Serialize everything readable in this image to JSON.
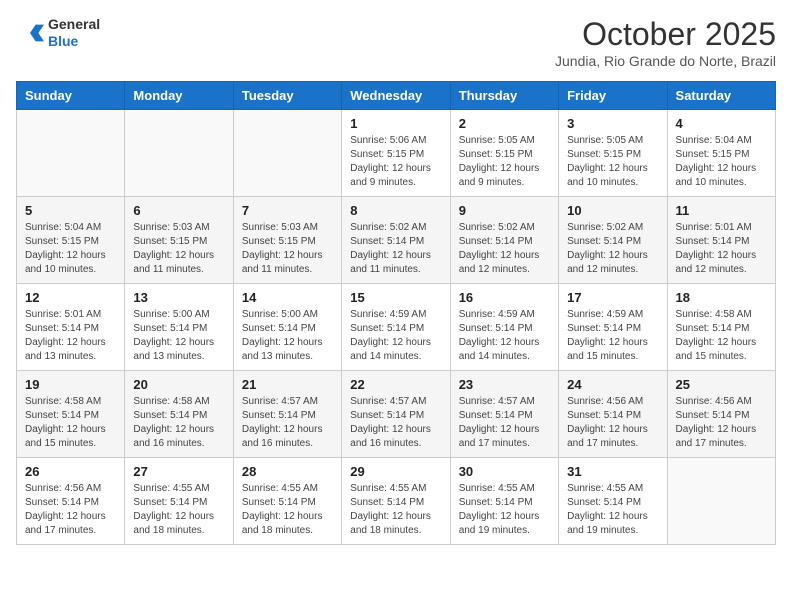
{
  "header": {
    "logo_general": "General",
    "logo_blue": "Blue",
    "title": "October 2025",
    "subtitle": "Jundia, Rio Grande do Norte, Brazil"
  },
  "calendar": {
    "days_of_week": [
      "Sunday",
      "Monday",
      "Tuesday",
      "Wednesday",
      "Thursday",
      "Friday",
      "Saturday"
    ],
    "weeks": [
      {
        "alt": false,
        "cells": [
          {
            "day": "",
            "info": ""
          },
          {
            "day": "",
            "info": ""
          },
          {
            "day": "",
            "info": ""
          },
          {
            "day": "1",
            "info": "Sunrise: 5:06 AM\nSunset: 5:15 PM\nDaylight: 12 hours and 9 minutes."
          },
          {
            "day": "2",
            "info": "Sunrise: 5:05 AM\nSunset: 5:15 PM\nDaylight: 12 hours and 9 minutes."
          },
          {
            "day": "3",
            "info": "Sunrise: 5:05 AM\nSunset: 5:15 PM\nDaylight: 12 hours and 10 minutes."
          },
          {
            "day": "4",
            "info": "Sunrise: 5:04 AM\nSunset: 5:15 PM\nDaylight: 12 hours and 10 minutes."
          }
        ]
      },
      {
        "alt": true,
        "cells": [
          {
            "day": "5",
            "info": "Sunrise: 5:04 AM\nSunset: 5:15 PM\nDaylight: 12 hours and 10 minutes."
          },
          {
            "day": "6",
            "info": "Sunrise: 5:03 AM\nSunset: 5:15 PM\nDaylight: 12 hours and 11 minutes."
          },
          {
            "day": "7",
            "info": "Sunrise: 5:03 AM\nSunset: 5:15 PM\nDaylight: 12 hours and 11 minutes."
          },
          {
            "day": "8",
            "info": "Sunrise: 5:02 AM\nSunset: 5:14 PM\nDaylight: 12 hours and 11 minutes."
          },
          {
            "day": "9",
            "info": "Sunrise: 5:02 AM\nSunset: 5:14 PM\nDaylight: 12 hours and 12 minutes."
          },
          {
            "day": "10",
            "info": "Sunrise: 5:02 AM\nSunset: 5:14 PM\nDaylight: 12 hours and 12 minutes."
          },
          {
            "day": "11",
            "info": "Sunrise: 5:01 AM\nSunset: 5:14 PM\nDaylight: 12 hours and 12 minutes."
          }
        ]
      },
      {
        "alt": false,
        "cells": [
          {
            "day": "12",
            "info": "Sunrise: 5:01 AM\nSunset: 5:14 PM\nDaylight: 12 hours and 13 minutes."
          },
          {
            "day": "13",
            "info": "Sunrise: 5:00 AM\nSunset: 5:14 PM\nDaylight: 12 hours and 13 minutes."
          },
          {
            "day": "14",
            "info": "Sunrise: 5:00 AM\nSunset: 5:14 PM\nDaylight: 12 hours and 13 minutes."
          },
          {
            "day": "15",
            "info": "Sunrise: 4:59 AM\nSunset: 5:14 PM\nDaylight: 12 hours and 14 minutes."
          },
          {
            "day": "16",
            "info": "Sunrise: 4:59 AM\nSunset: 5:14 PM\nDaylight: 12 hours and 14 minutes."
          },
          {
            "day": "17",
            "info": "Sunrise: 4:59 AM\nSunset: 5:14 PM\nDaylight: 12 hours and 15 minutes."
          },
          {
            "day": "18",
            "info": "Sunrise: 4:58 AM\nSunset: 5:14 PM\nDaylight: 12 hours and 15 minutes."
          }
        ]
      },
      {
        "alt": true,
        "cells": [
          {
            "day": "19",
            "info": "Sunrise: 4:58 AM\nSunset: 5:14 PM\nDaylight: 12 hours and 15 minutes."
          },
          {
            "day": "20",
            "info": "Sunrise: 4:58 AM\nSunset: 5:14 PM\nDaylight: 12 hours and 16 minutes."
          },
          {
            "day": "21",
            "info": "Sunrise: 4:57 AM\nSunset: 5:14 PM\nDaylight: 12 hours and 16 minutes."
          },
          {
            "day": "22",
            "info": "Sunrise: 4:57 AM\nSunset: 5:14 PM\nDaylight: 12 hours and 16 minutes."
          },
          {
            "day": "23",
            "info": "Sunrise: 4:57 AM\nSunset: 5:14 PM\nDaylight: 12 hours and 17 minutes."
          },
          {
            "day": "24",
            "info": "Sunrise: 4:56 AM\nSunset: 5:14 PM\nDaylight: 12 hours and 17 minutes."
          },
          {
            "day": "25",
            "info": "Sunrise: 4:56 AM\nSunset: 5:14 PM\nDaylight: 12 hours and 17 minutes."
          }
        ]
      },
      {
        "alt": false,
        "cells": [
          {
            "day": "26",
            "info": "Sunrise: 4:56 AM\nSunset: 5:14 PM\nDaylight: 12 hours and 17 minutes."
          },
          {
            "day": "27",
            "info": "Sunrise: 4:55 AM\nSunset: 5:14 PM\nDaylight: 12 hours and 18 minutes."
          },
          {
            "day": "28",
            "info": "Sunrise: 4:55 AM\nSunset: 5:14 PM\nDaylight: 12 hours and 18 minutes."
          },
          {
            "day": "29",
            "info": "Sunrise: 4:55 AM\nSunset: 5:14 PM\nDaylight: 12 hours and 18 minutes."
          },
          {
            "day": "30",
            "info": "Sunrise: 4:55 AM\nSunset: 5:14 PM\nDaylight: 12 hours and 19 minutes."
          },
          {
            "day": "31",
            "info": "Sunrise: 4:55 AM\nSunset: 5:14 PM\nDaylight: 12 hours and 19 minutes."
          },
          {
            "day": "",
            "info": ""
          }
        ]
      }
    ]
  }
}
